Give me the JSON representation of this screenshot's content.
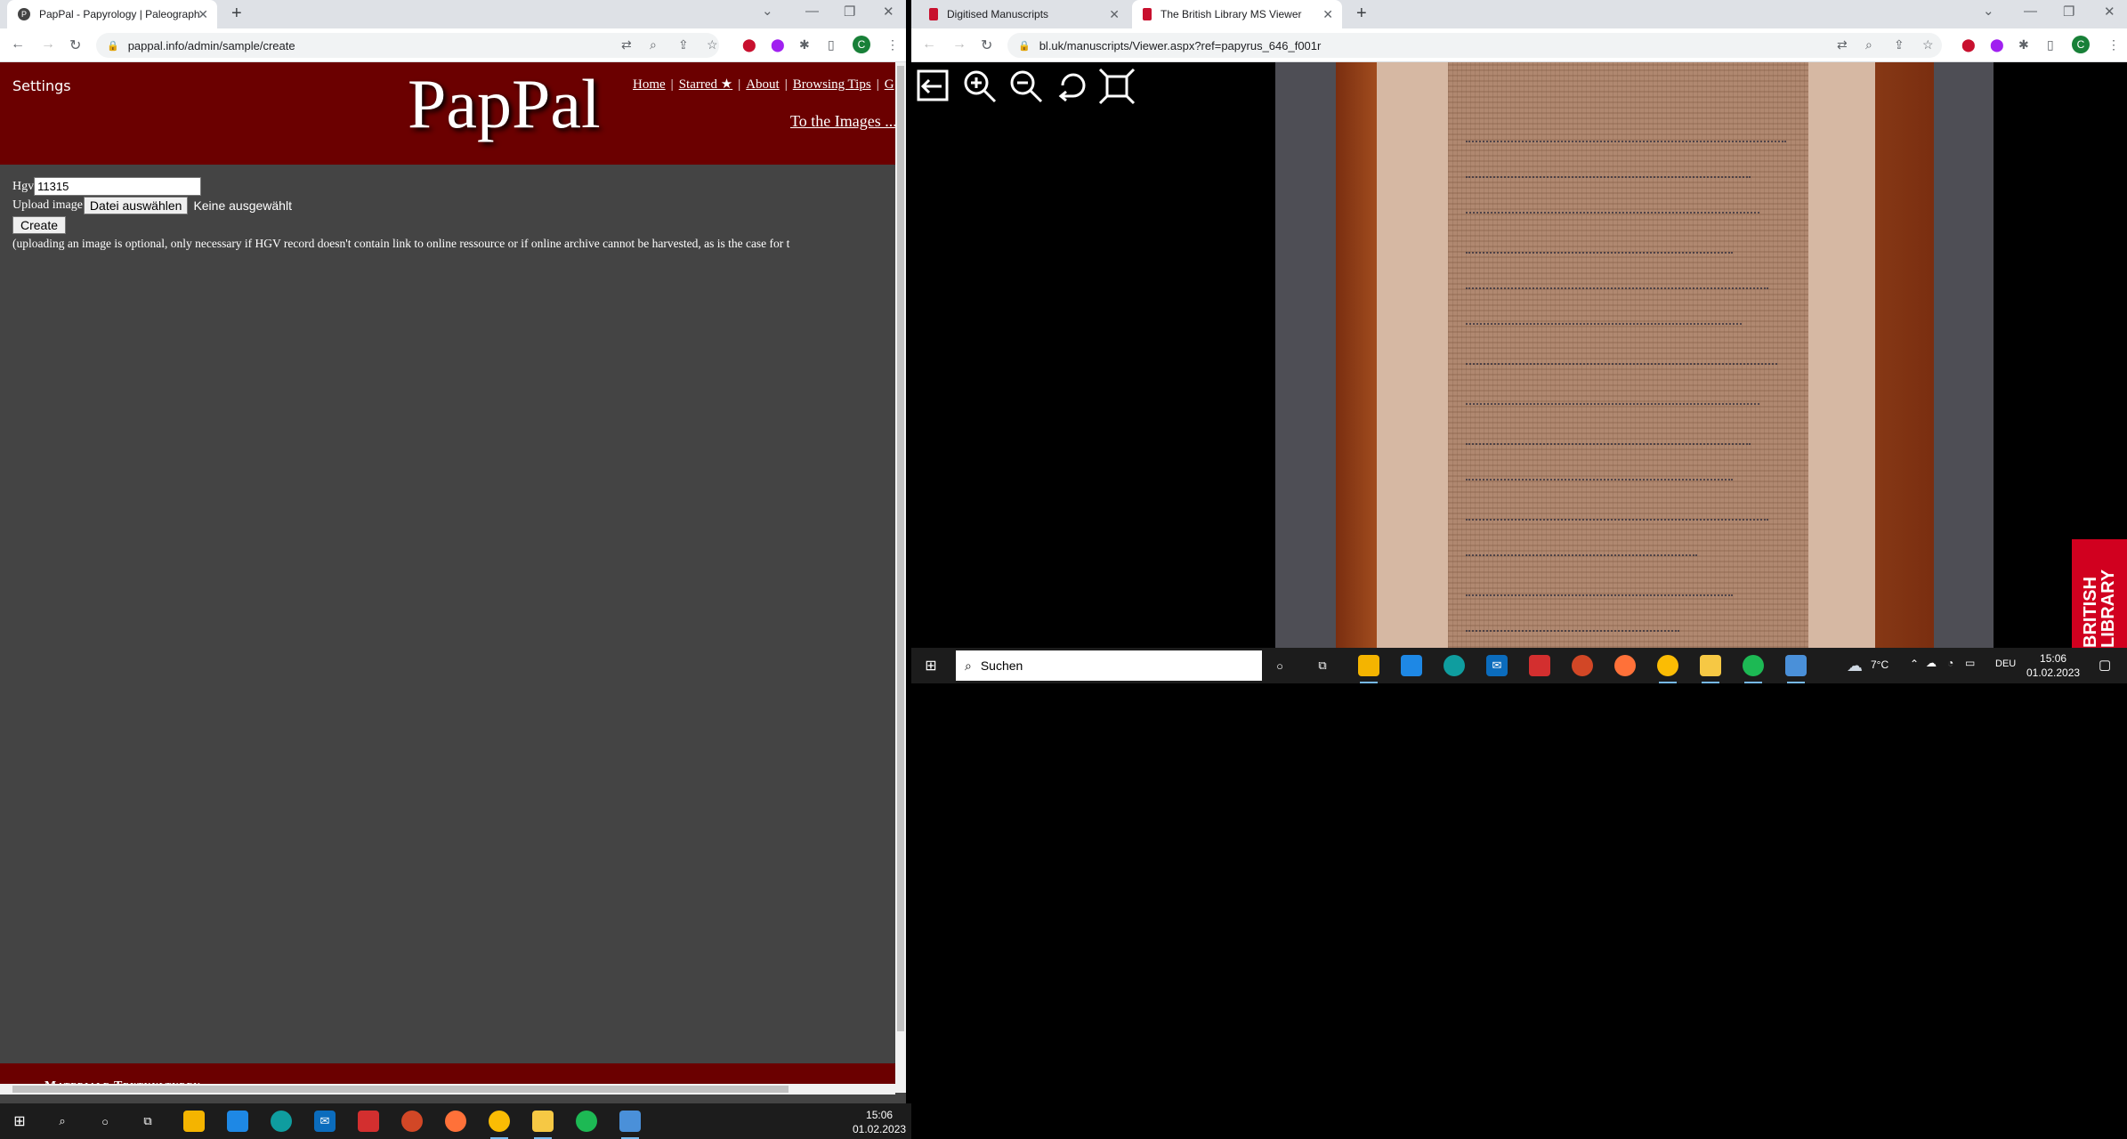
{
  "left_browser": {
    "tab_title": "PapPal - Papyrology | Paleograph",
    "url": "pappal.info/admin/sample/create",
    "avatar_letter": "C"
  },
  "pappal": {
    "settings": "Settings",
    "logo": "PapPal",
    "nav": [
      "Home",
      "Starred ★",
      "About",
      "Browsing Tips",
      "G"
    ],
    "to_images": "To the Images ...",
    "form": {
      "hgv_label": "Hgv",
      "hgv_value": "11315",
      "upload_label": "Upload image",
      "file_button": "Datei auswählen",
      "file_status": "Keine ausgewählt",
      "create_button": "Create",
      "note": "(uploading an image is optional, only necessary if HGV record doesn't contain link to online ressource or if online archive cannot be harvested, as is the case for t"
    },
    "footer": "Materiale Textkulturen"
  },
  "right_browser": {
    "tabs": [
      "Digitised Manuscripts",
      "The British Library MS Viewer"
    ],
    "url": "bl.uk/manuscripts/Viewer.aspx?ref=papyrus_646_f001r",
    "avatar_letter": "C",
    "badge": "BRITISH LIBRARY"
  },
  "taskbar_right": {
    "search_placeholder": "Suchen",
    "weather": "7°C",
    "lang": "DEU",
    "time": "15:06",
    "date": "01.02.2023"
  },
  "taskbar_left": {
    "time": "15:06",
    "date": "01.02.2023"
  },
  "colors": {
    "pappal_red": "#6b0000",
    "page_bg": "#444444"
  }
}
